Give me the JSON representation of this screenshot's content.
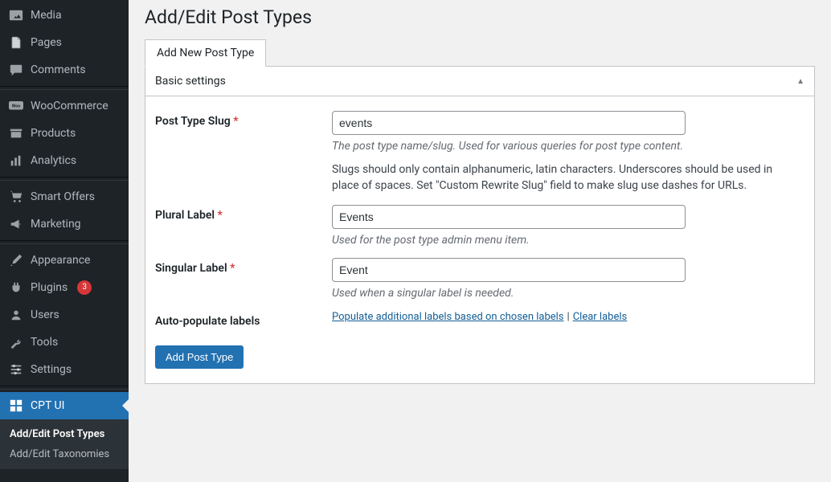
{
  "sidebar": {
    "items": [
      {
        "label": "Media",
        "name": "media"
      },
      {
        "label": "Pages",
        "name": "pages"
      },
      {
        "label": "Comments",
        "name": "comments"
      },
      {
        "label": "WooCommerce",
        "name": "woocommerce"
      },
      {
        "label": "Products",
        "name": "products"
      },
      {
        "label": "Analytics",
        "name": "analytics"
      },
      {
        "label": "Smart Offers",
        "name": "smart-offers"
      },
      {
        "label": "Marketing",
        "name": "marketing"
      },
      {
        "label": "Appearance",
        "name": "appearance"
      },
      {
        "label": "Plugins",
        "name": "plugins"
      },
      {
        "label": "Users",
        "name": "users"
      },
      {
        "label": "Tools",
        "name": "tools"
      },
      {
        "label": "Settings",
        "name": "settings"
      },
      {
        "label": "CPT UI",
        "name": "cpt-ui"
      }
    ],
    "plugin_badge": "3",
    "submenu": {
      "add_edit_post_types": "Add/Edit Post Types",
      "add_edit_taxonomies": "Add/Edit Taxonomies"
    }
  },
  "page": {
    "title": "Add/Edit Post Types",
    "tab_label": "Add New Post Type",
    "panel_title": "Basic settings"
  },
  "form": {
    "slug": {
      "label": "Post Type Slug",
      "value": "events",
      "hint": "The post type name/slug. Used for various queries for post type content.",
      "note": "Slugs should only contain alphanumeric, latin characters. Underscores should be used in place of spaces. Set \"Custom Rewrite Slug\" field to make slug use dashes for URLs."
    },
    "plural": {
      "label": "Plural Label",
      "value": "Events",
      "hint": "Used for the post type admin menu item."
    },
    "singular": {
      "label": "Singular Label",
      "value": "Event",
      "hint": "Used when a singular label is needed."
    },
    "autopop": {
      "label": "Auto-populate labels",
      "link1": "Populate additional labels based on chosen labels",
      "sep": "|",
      "link2": "Clear labels"
    },
    "submit": "Add Post Type"
  }
}
